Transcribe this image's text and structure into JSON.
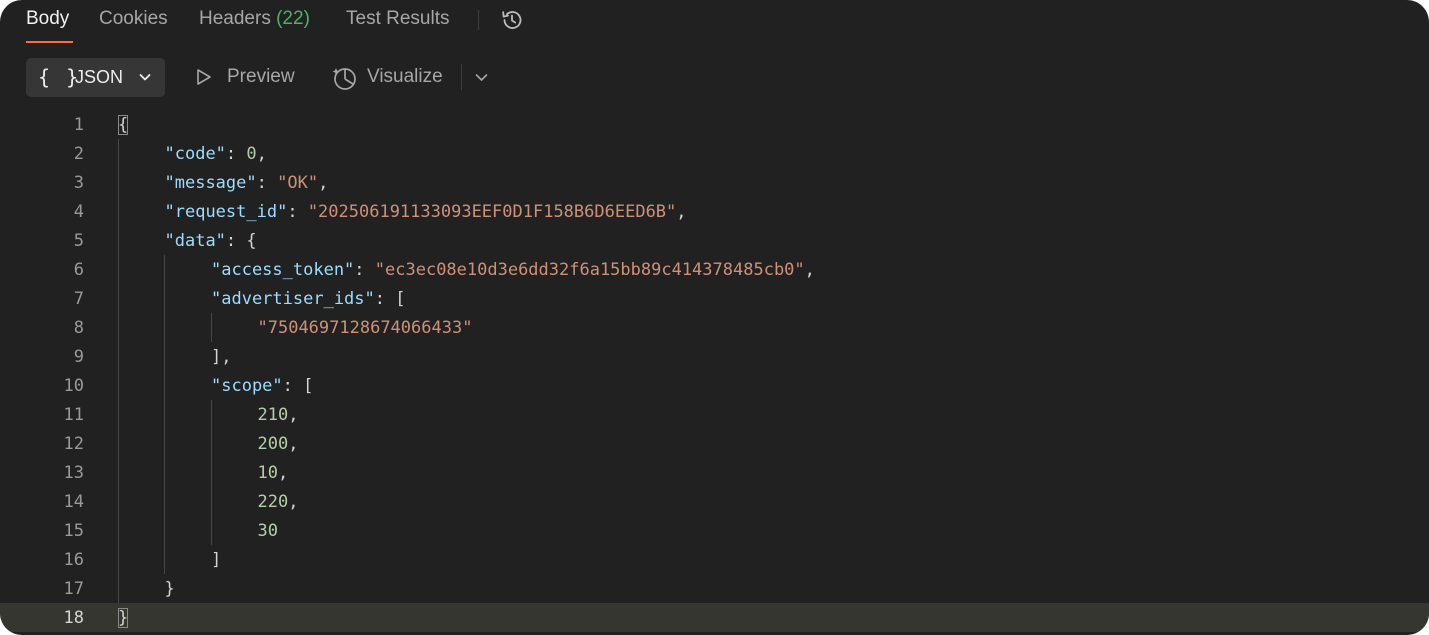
{
  "tabs": [
    {
      "label": "Body",
      "active": true
    },
    {
      "label": "Cookies",
      "active": false
    },
    {
      "label": "Headers",
      "count": "(22)",
      "active": false
    },
    {
      "label": "Test Results",
      "active": false
    }
  ],
  "toolbar": {
    "format_braces": "{ }",
    "format_label": "JSON",
    "preview_label": "Preview",
    "visualize_label": "Visualize"
  },
  "colors": {
    "background": "#212121",
    "accent": "#ff6c37",
    "count_green": "#46b46b",
    "json_key": "#9cdcfe",
    "json_string": "#ce9178",
    "json_number": "#b5cea8"
  },
  "icons": [
    "history-icon",
    "chevron-down-icon",
    "play-icon",
    "visualize-icon"
  ],
  "editor": {
    "current_line": 18,
    "lines": [
      {
        "n": "1",
        "tokens": [
          {
            "t": "{",
            "c": "punc"
          }
        ]
      },
      {
        "n": "2",
        "tokens": [
          {
            "t": "\"code\"",
            "c": "key"
          },
          {
            "t": ": ",
            "c": "punc"
          },
          {
            "t": "0",
            "c": "num"
          },
          {
            "t": ",",
            "c": "punc"
          }
        ]
      },
      {
        "n": "3",
        "tokens": [
          {
            "t": "\"message\"",
            "c": "key"
          },
          {
            "t": ": ",
            "c": "punc"
          },
          {
            "t": "\"OK\"",
            "c": "str"
          },
          {
            "t": ",",
            "c": "punc"
          }
        ]
      },
      {
        "n": "4",
        "tokens": [
          {
            "t": "\"request_id\"",
            "c": "key"
          },
          {
            "t": ": ",
            "c": "punc"
          },
          {
            "t": "\"20250619113309​3EEF0D1F158B6D6EED6B\"",
            "c": "str"
          },
          {
            "t": ",",
            "c": "punc"
          }
        ]
      },
      {
        "n": "5",
        "tokens": [
          {
            "t": "\"data\"",
            "c": "key"
          },
          {
            "t": ": {",
            "c": "punc"
          }
        ]
      },
      {
        "n": "6",
        "tokens": [
          {
            "t": "\"access_token\"",
            "c": "key"
          },
          {
            "t": ": ",
            "c": "punc"
          },
          {
            "t": "\"ec3ec08e10d3e6dd32f6a15bb89c414378485cb0\"",
            "c": "str"
          },
          {
            "t": ",",
            "c": "punc"
          }
        ]
      },
      {
        "n": "7",
        "tokens": [
          {
            "t": "\"advertiser_ids\"",
            "c": "key"
          },
          {
            "t": ": [",
            "c": "punc"
          }
        ]
      },
      {
        "n": "8",
        "tokens": [
          {
            "t": "\"7504697128674066433\"",
            "c": "str"
          }
        ]
      },
      {
        "n": "9",
        "tokens": [
          {
            "t": "],",
            "c": "punc"
          }
        ]
      },
      {
        "n": "10",
        "tokens": [
          {
            "t": "\"scope\"",
            "c": "key"
          },
          {
            "t": ": [",
            "c": "punc"
          }
        ]
      },
      {
        "n": "11",
        "tokens": [
          {
            "t": "210",
            "c": "num"
          },
          {
            "t": ",",
            "c": "punc"
          }
        ]
      },
      {
        "n": "12",
        "tokens": [
          {
            "t": "200",
            "c": "num"
          },
          {
            "t": ",",
            "c": "punc"
          }
        ]
      },
      {
        "n": "13",
        "tokens": [
          {
            "t": "10",
            "c": "num"
          },
          {
            "t": ",",
            "c": "punc"
          }
        ]
      },
      {
        "n": "14",
        "tokens": [
          {
            "t": "220",
            "c": "num"
          },
          {
            "t": ",",
            "c": "punc"
          }
        ]
      },
      {
        "n": "15",
        "tokens": [
          {
            "t": "30",
            "c": "num"
          }
        ]
      },
      {
        "n": "16",
        "tokens": [
          {
            "t": "]",
            "c": "punc"
          }
        ]
      },
      {
        "n": "17",
        "tokens": [
          {
            "t": "}",
            "c": "punc"
          }
        ]
      },
      {
        "n": "18",
        "tokens": [
          {
            "t": "}",
            "c": "punc"
          }
        ]
      }
    ]
  }
}
